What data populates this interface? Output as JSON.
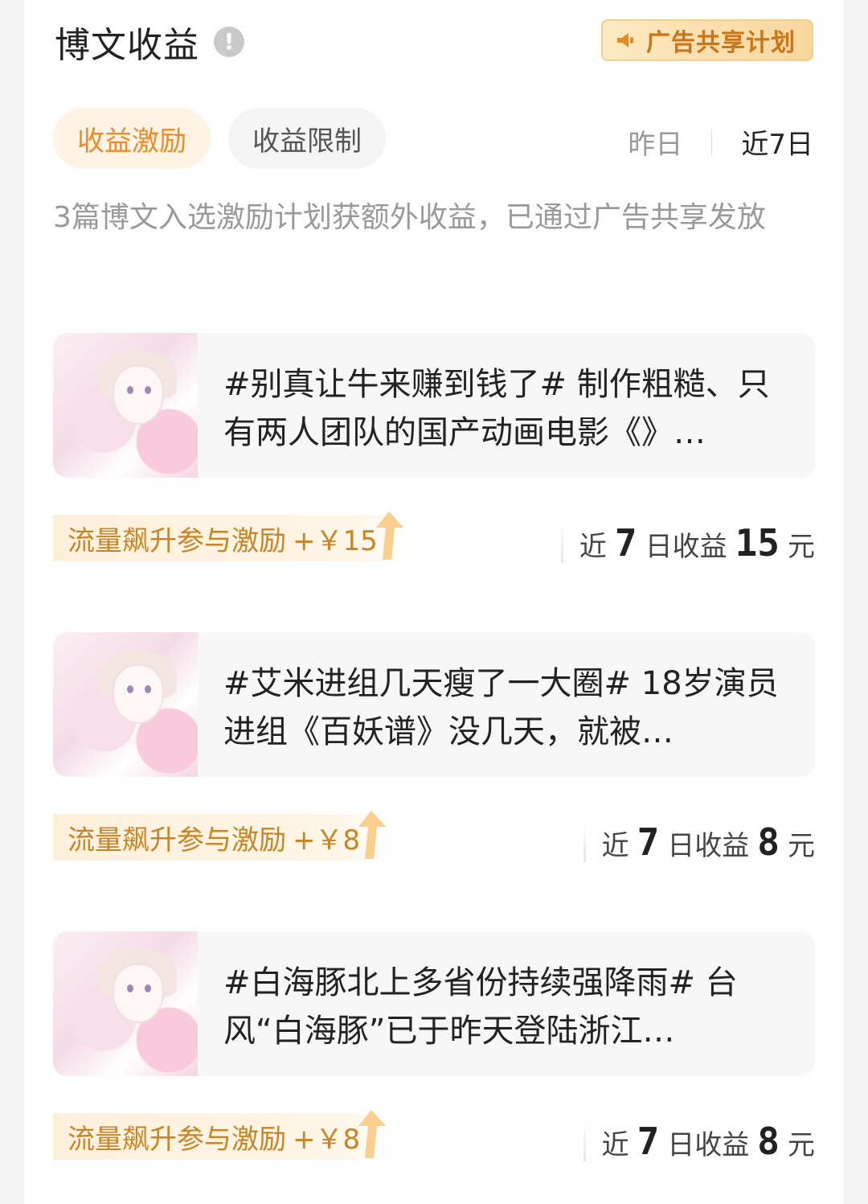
{
  "header": {
    "title": "博文收益",
    "ad_plan_label": "广告共享计划"
  },
  "tabs": [
    {
      "label": "收益激励"
    },
    {
      "label": "收益限制"
    }
  ],
  "range": {
    "yesterday": "昨日",
    "last7": "近7日"
  },
  "description": "3篇博文入选激励计划获额外收益，已通过广告共享发放",
  "posts": [
    {
      "text": "#别真让牛来赚到钱了# 制作粗糙、只有两人团队的国产动画电影《》…",
      "incentive_label": "流量飙升参与激励",
      "incentive_amount": "+￥15",
      "earning_prefix": "近",
      "earning_days": "7",
      "earning_mid": "日收益",
      "earning_value": "15",
      "earning_unit": "元"
    },
    {
      "text": "#艾米进组几天瘦了一大圈# 18岁演员进组《百妖谱》没几天，就被…",
      "incentive_label": "流量飙升参与激励",
      "incentive_amount": "+￥8",
      "earning_prefix": "近",
      "earning_days": "7",
      "earning_mid": "日收益",
      "earning_value": "8",
      "earning_unit": "元"
    },
    {
      "text": "#白海豚北上多省份持续强降雨# 台风“白海豚”已于昨天登陆浙江…",
      "incentive_label": "流量飙升参与激励",
      "incentive_amount": "+￥8",
      "earning_prefix": "近",
      "earning_days": "7",
      "earning_mid": "日收益",
      "earning_value": "8",
      "earning_unit": "元"
    }
  ],
  "colors": {
    "accent": "#f08a24",
    "incentive_text": "#c98424",
    "ad_plan_bg": "#f8d79d"
  }
}
